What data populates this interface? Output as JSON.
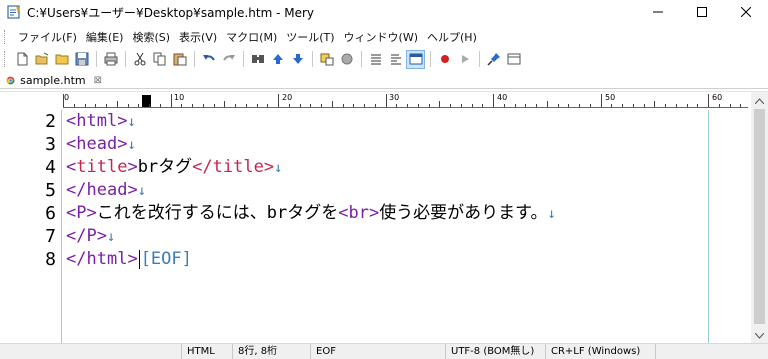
{
  "window": {
    "title": "C:¥Users¥ユーザー¥Desktop¥sample.htm - Mery"
  },
  "menu": {
    "items": [
      "ファイル(F)",
      "編集(E)",
      "検索(S)",
      "表示(V)",
      "マクロ(M)",
      "ツール(T)",
      "ウィンドウ(W)",
      "ヘルプ(H)"
    ]
  },
  "toolbar": {
    "icons": [
      "new-icon",
      "open-icon",
      "open-folder-icon",
      "save-icon",
      "print-icon",
      "cut-icon",
      "copy-icon",
      "paste-icon",
      "undo-icon",
      "redo-icon",
      "find-icon",
      "find-prev-icon",
      "find-next-icon",
      "replace-icon",
      "clear-highlight-icon",
      "list-icon",
      "list2-icon",
      "view-icon",
      "record-icon",
      "play-icon",
      "pin-icon",
      "window-icon"
    ]
  },
  "tab": {
    "label": "sample.htm",
    "close": "⊠"
  },
  "ruler": {
    "labels": [
      "0",
      "10",
      "20",
      "30",
      "40",
      "50",
      "60"
    ]
  },
  "editor": {
    "line_numbers": [
      "2",
      "3",
      "4",
      "5",
      "6",
      "7",
      "8"
    ],
    "lines": [
      {
        "open": "<",
        "name": "html",
        "close": ">",
        "text": "",
        "eol": "↓"
      },
      {
        "open": "<",
        "name": "head",
        "close": ">",
        "text": "",
        "eol": "↓"
      },
      {
        "open": "<",
        "name": "title",
        "close": ">",
        "text": "brタグ",
        "end_tag": "</title>",
        "eol": "↓"
      },
      {
        "open": "</",
        "name": "head",
        "close": ">",
        "text": "",
        "eol": "↓"
      },
      {
        "open": "<",
        "name": "P",
        "close": ">",
        "text": "これを改行するには、brタグを",
        "inner_tag": "<br>",
        "text2": "使う必要があります。",
        "eol": "↓"
      },
      {
        "open": "</",
        "name": "P",
        "close": ">",
        "text": "",
        "eol": "↓"
      },
      {
        "open": "</",
        "name": "html",
        "close": ">",
        "text": "",
        "eof": "[EOF]"
      }
    ]
  },
  "status": {
    "mode": "HTML",
    "position": "8行, 8桁",
    "state": "EOF",
    "encoding": "UTF-8 (BOM無し)",
    "line_ending": "CR+LF (Windows)"
  },
  "colors": {
    "tag_bracket": "#7a1fa8",
    "tag_name": "#c7254e",
    "eol_marker": "#3b7db8"
  }
}
